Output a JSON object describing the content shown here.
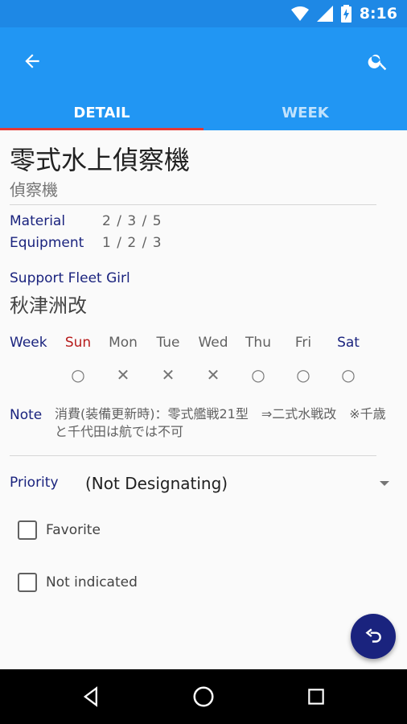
{
  "status_bar": {
    "time": "8:16",
    "icons": [
      "wifi-icon",
      "signal-icon",
      "battery-charging-icon"
    ]
  },
  "app_bar": {
    "back_icon": "arrow-back-icon",
    "search_icon": "search-icon",
    "tabs": [
      {
        "label": "DETAIL",
        "active": true
      },
      {
        "label": "WEEK",
        "active": false
      }
    ],
    "colors": {
      "primary": "#2196f3",
      "status": "#1e88e5",
      "indicator": "#e53935"
    }
  },
  "item": {
    "name": "零式水上偵察機",
    "type": "偵察機",
    "material_label": "Material",
    "material_value": "2 / 3 / 5",
    "equipment_label": "Equipment",
    "equipment_value": "1 / 2 / 3",
    "support_label": "Support Fleet Girl",
    "support_name": "秋津洲改"
  },
  "week": {
    "label": "Week",
    "days": [
      "Sun",
      "Mon",
      "Tue",
      "Wed",
      "Thu",
      "Fri",
      "Sat"
    ],
    "marks": [
      "○",
      "✕",
      "✕",
      "✕",
      "○",
      "○",
      "○"
    ]
  },
  "note": {
    "label": "Note",
    "text": "消費(装備更新時)：零式艦戦21型　⇒二式水戦改　※千歳と千代田は航では不可"
  },
  "priority": {
    "label": "Priority",
    "value": "(Not Designating)"
  },
  "checkboxes": [
    {
      "label": "Favorite",
      "checked": false
    },
    {
      "label": "Not indicated",
      "checked": false
    }
  ],
  "fab": {
    "icon": "undo-icon",
    "color": "#1a237e"
  },
  "nav": {
    "icons": [
      "back-triangle-icon",
      "home-circle-icon",
      "recents-square-icon"
    ]
  }
}
